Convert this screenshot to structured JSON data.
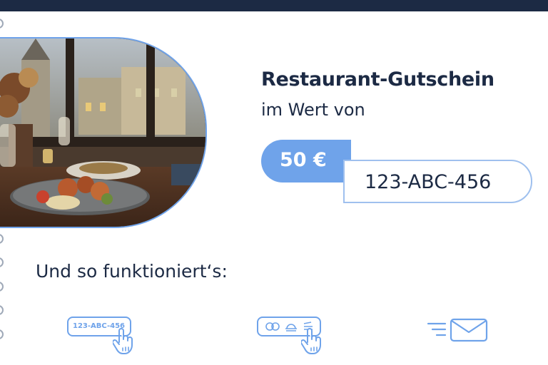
{
  "voucher": {
    "title": "Restaurant-Gutschein",
    "subtitle": "im Wert von",
    "price": "50 €",
    "code": "123-ABC-456"
  },
  "howto": {
    "heading": "Und so funktioniert‘s:",
    "steps": [
      {
        "icon": "code-tap-icon",
        "text": "123-ABC-456"
      },
      {
        "icon": "restaurant-select-icon"
      },
      {
        "icon": "email-icon"
      }
    ]
  },
  "colors": {
    "navy": "#1c2a44",
    "accent": "#6fa3ea",
    "accent_light": "#9fc0ee"
  },
  "image": {
    "description_icon": "restaurant-photo"
  }
}
